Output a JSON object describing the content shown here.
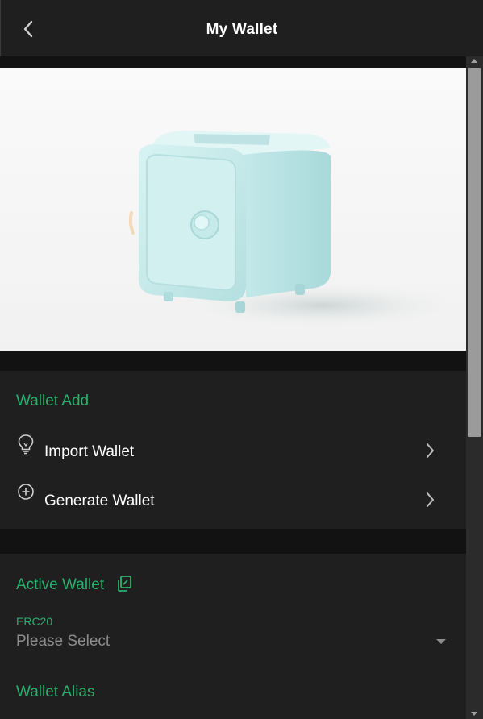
{
  "header": {
    "title": "My Wallet",
    "back_icon": "chevron-left-icon"
  },
  "hero": {
    "illustration": "safe-illustration",
    "safe_color": "#c9ecec"
  },
  "wallet_add": {
    "title": "Wallet Add",
    "items": [
      {
        "label": "Import Wallet",
        "icon": "lightbulb-icon"
      },
      {
        "label": "Generate Wallet",
        "icon": "plus-circle-icon"
      }
    ]
  },
  "active_wallet": {
    "title": "Active Wallet",
    "copy_icon": "copy-icon",
    "network_label": "ERC20",
    "select_placeholder": "Please Select",
    "alias_title": "Wallet Alias"
  },
  "colors": {
    "accent": "#27b26e",
    "panel": "#1f1f1f",
    "background": "#121212",
    "muted_text": "#8d8d8d"
  }
}
